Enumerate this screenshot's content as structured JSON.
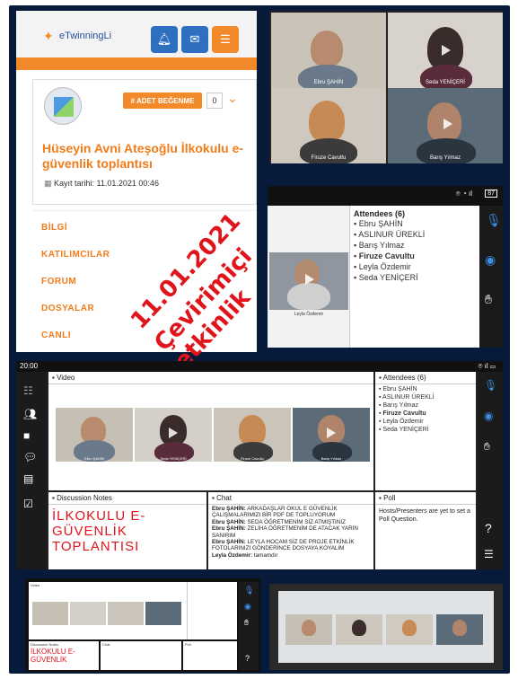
{
  "twinning": {
    "logo_text": "eTwinningLi",
    "like_button": "# ADET BEĞENME",
    "like_count": "0",
    "meeting_title": "Hüseyin Avni Ateşoğlu İlkokulu e-güvenlik toplantısı",
    "record_date": "Kayıt tarihi: 11.01.2021 00:46",
    "menu": [
      "BİLGİ",
      "KATILIMCILAR",
      "FORUM",
      "DOSYALAR",
      "CANLI"
    ]
  },
  "stamp": {
    "line1": "11.01.2021",
    "line2": "Çevirimiçi etkinlik"
  },
  "grid": {
    "participants": [
      "Ebru ŞAHİN",
      "Seda YENİÇERİ",
      "Firuze Cavultu",
      "Barış Yılmaz"
    ]
  },
  "phone1": {
    "battery": "87",
    "attendees_title": "Attendees (6)",
    "attendees": [
      "Ebru ŞAHİN",
      "ASLINUR ÜREKLİ",
      "Barış Yılmaz",
      "Firuze Cavultu",
      "Leyla Özdemir",
      "Seda YENİÇERİ"
    ],
    "video_name": "Leyla Özdemir"
  },
  "phone2": {
    "time": "20:00",
    "video_title": "Video",
    "tile_names": [
      "Ebru ŞAHİN",
      "Seda YENİÇERİ",
      "Firuze Cavultu",
      "Barış Yılmaz"
    ],
    "attendees_title": "Attendees (6)",
    "attendees": [
      "Ebru ŞAHİN",
      "ASLINUR ÜREKLİ",
      "Barış Yılmaz",
      "Firuze Cavultu",
      "Leyla Özdemir",
      "Seda YENİÇERİ"
    ],
    "notes_title": "Discussion Notes",
    "notes_text": [
      "İLKOKULU E-",
      "GÜVENLİK",
      "TOPLANTISI"
    ],
    "chat_title": "Chat",
    "chat": [
      {
        "who": "Ebru ŞAHİN:",
        "text": "ARKADAŞLAR OKUL E GÜVENLİK ÇALIŞMALARIMIZI BİR PDF DE TOPLUYORUM"
      },
      {
        "who": "Ebru ŞAHİN:",
        "text": "SEDA ÖĞRETMENİM SİZ ATMIŞTINIZ"
      },
      {
        "who": "Ebru ŞAHİN:",
        "text": "ZELİHA ÖĞRETMENİM DE ATACAK YARIN SANIRIM"
      },
      {
        "who": "Ebru ŞAHİN:",
        "text": "LEYLA HOCAM SİZ DE PROJE ETKİNLİK FOTOLARINIZI GÖNDERİNCE DOSYAYA KOYALIM"
      },
      {
        "who": "Leyla Özdemir:",
        "text": "tamamdır"
      }
    ],
    "poll_title": "Poll",
    "poll_text": "Hosts/Presenters are yet to set a Poll Question.",
    "help": "?"
  },
  "phone3": {
    "video_title": "Video",
    "notes_title": "Discussion Notes",
    "notes_text": [
      "İLKOKULU E-",
      "GÜVENLİK"
    ],
    "chat_title": "Chat",
    "poll_title": "Poll"
  },
  "colors": {
    "accent_orange": "#f28a2b",
    "stamp_red": "#e0141b",
    "adobe_blue": "#3d8ee8",
    "frame_navy": "#071a3a"
  }
}
